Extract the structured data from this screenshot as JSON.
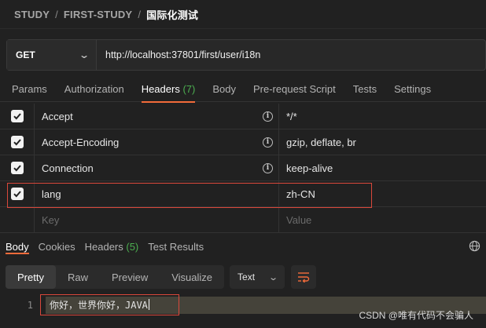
{
  "breadcrumb": {
    "workspace": "STUDY",
    "collection": "FIRST-STUDY",
    "request": "国际化测试",
    "separator": "/"
  },
  "request": {
    "method": "GET",
    "url": "http://localhost:37801/first/user/i18n"
  },
  "request_tabs": [
    {
      "label": "Params"
    },
    {
      "label": "Authorization"
    },
    {
      "label": "Headers",
      "count": "(7)",
      "active": true
    },
    {
      "label": "Body"
    },
    {
      "label": "Pre-request Script"
    },
    {
      "label": "Tests"
    },
    {
      "label": "Settings"
    }
  ],
  "headers": [
    {
      "key": "Accept",
      "value": "*/*",
      "checked": true,
      "info": true
    },
    {
      "key": "Accept-Encoding",
      "value": "gzip, deflate, br",
      "checked": true,
      "info": true
    },
    {
      "key": "Connection",
      "value": "keep-alive",
      "checked": true,
      "info": true
    },
    {
      "key": "lang",
      "value": "zh-CN",
      "checked": true,
      "info": false
    }
  ],
  "header_placeholder": {
    "key": "Key",
    "value": "Value"
  },
  "response_tabs": [
    {
      "label": "Body",
      "active": true
    },
    {
      "label": "Cookies"
    },
    {
      "label": "Headers",
      "count": "(5)"
    },
    {
      "label": "Test Results"
    }
  ],
  "view_modes": [
    "Pretty",
    "Raw",
    "Preview",
    "Visualize"
  ],
  "active_view": "Pretty",
  "format": "Text",
  "response_body": {
    "line_number": "1",
    "text": "你好，世界你好，JAVA"
  },
  "watermark": "CSDN @唯有代码不会骗人",
  "colors": {
    "accent": "#f26b3a",
    "count_green": "#4caf50",
    "highlight_box": "#d9483b"
  },
  "icons": {
    "method_dropdown": "chevron-down-icon",
    "info": "info-icon",
    "globe": "globe-icon",
    "wrap": "wrap-lines-icon"
  }
}
